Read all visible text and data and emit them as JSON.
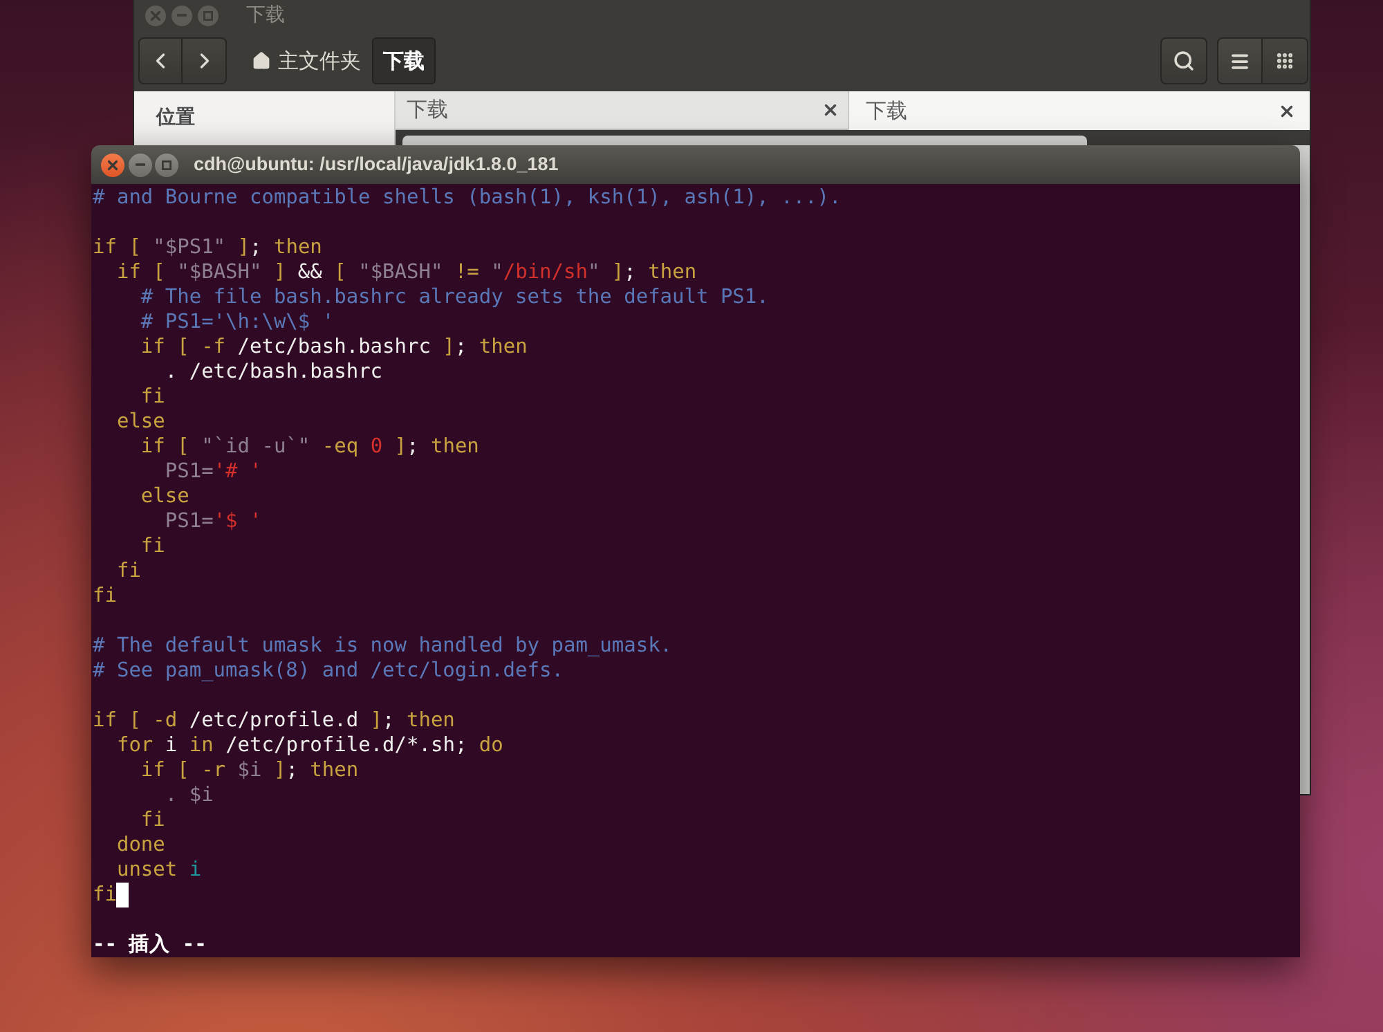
{
  "file_manager": {
    "title": "下载",
    "focused": false,
    "path": [
      {
        "label": "主文件夹",
        "selected": false
      },
      {
        "label": "下载",
        "selected": true
      }
    ],
    "sidebar": {
      "heading": "位置"
    },
    "tabs": [
      {
        "label": "下载",
        "selected": false
      },
      {
        "label": "下载",
        "selected": true
      }
    ]
  },
  "terminal": {
    "title": "cdh@ubuntu: /usr/local/java/jdk1.8.0_181",
    "focused": true,
    "blocks": [
      {
        "lines": [
          {
            "cursor": false,
            "tokens": [
              {
                "kind": "comment",
                "text": "# and Bourne compatible shells (bash(1), ksh(1), ash(1), ...)."
              }
            ]
          }
        ]
      },
      {
        "lines": [
          {
            "cursor": false,
            "tokens": [
              {
                "kind": "keyword",
                "text": "if [ "
              },
              {
                "kind": "variable",
                "text": "\"$PS1\""
              },
              {
                "kind": "keyword",
                "text": " ]"
              },
              {
                "kind": "plain",
                "text": ";"
              },
              {
                "kind": "keyword",
                "text": " then"
              }
            ]
          },
          {
            "cursor": false,
            "tokens": [
              {
                "kind": "keyword",
                "text": "  if [ "
              },
              {
                "kind": "variable",
                "text": "\"$BASH\""
              },
              {
                "kind": "keyword",
                "text": " ]"
              },
              {
                "kind": "plain",
                "text": " && "
              },
              {
                "kind": "keyword",
                "text": "[ "
              },
              {
                "kind": "variable",
                "text": "\"$BASH\""
              },
              {
                "kind": "keyword",
                "text": " != "
              },
              {
                "kind": "variable",
                "text": "\""
              },
              {
                "kind": "string",
                "text": "/bin/sh"
              },
              {
                "kind": "variable",
                "text": "\""
              },
              {
                "kind": "keyword",
                "text": " ]"
              },
              {
                "kind": "plain",
                "text": ";"
              },
              {
                "kind": "keyword",
                "text": " then"
              }
            ]
          },
          {
            "cursor": false,
            "tokens": [
              {
                "kind": "comment",
                "text": "    # The file bash.bashrc already sets the default PS1."
              }
            ]
          },
          {
            "cursor": false,
            "tokens": [
              {
                "kind": "comment",
                "text": "    # PS1='\\h:\\w\\$ '"
              }
            ]
          },
          {
            "cursor": false,
            "tokens": [
              {
                "kind": "keyword",
                "text": "    if [ -f "
              },
              {
                "kind": "plain",
                "text": "/etc/bash.bashrc"
              },
              {
                "kind": "keyword",
                "text": " ]"
              },
              {
                "kind": "plain",
                "text": ";"
              },
              {
                "kind": "keyword",
                "text": " then"
              }
            ]
          },
          {
            "cursor": false,
            "tokens": [
              {
                "kind": "plain",
                "text": "      . /etc/bash.bashrc"
              }
            ]
          },
          {
            "cursor": false,
            "tokens": [
              {
                "kind": "keyword",
                "text": "    fi"
              }
            ]
          },
          {
            "cursor": false,
            "tokens": [
              {
                "kind": "keyword",
                "text": "  else"
              }
            ]
          },
          {
            "cursor": false,
            "tokens": [
              {
                "kind": "keyword",
                "text": "    if [ "
              },
              {
                "kind": "variable",
                "text": "\"`id -u`\""
              },
              {
                "kind": "keyword",
                "text": " -eq "
              },
              {
                "kind": "string",
                "text": "0"
              },
              {
                "kind": "keyword",
                "text": " ]"
              },
              {
                "kind": "plain",
                "text": ";"
              },
              {
                "kind": "keyword",
                "text": " then"
              }
            ]
          },
          {
            "cursor": false,
            "tokens": [
              {
                "kind": "variable",
                "text": "      PS1="
              },
              {
                "kind": "string",
                "text": "'# '"
              }
            ]
          },
          {
            "cursor": false,
            "tokens": [
              {
                "kind": "keyword",
                "text": "    else"
              }
            ]
          },
          {
            "cursor": false,
            "tokens": [
              {
                "kind": "variable",
                "text": "      PS1="
              },
              {
                "kind": "string",
                "text": "'$ '"
              }
            ]
          },
          {
            "cursor": false,
            "tokens": [
              {
                "kind": "keyword",
                "text": "    fi"
              }
            ]
          },
          {
            "cursor": false,
            "tokens": [
              {
                "kind": "keyword",
                "text": "  fi"
              }
            ]
          },
          {
            "cursor": false,
            "tokens": [
              {
                "kind": "keyword",
                "text": "fi"
              }
            ]
          }
        ]
      },
      {
        "lines": [
          {
            "cursor": false,
            "tokens": [
              {
                "kind": "comment",
                "text": "# The default umask is now handled by pam_umask."
              }
            ]
          },
          {
            "cursor": false,
            "tokens": [
              {
                "kind": "comment",
                "text": "# See pam_umask(8) and /etc/login.defs."
              }
            ]
          }
        ]
      },
      {
        "lines": [
          {
            "cursor": false,
            "tokens": [
              {
                "kind": "keyword",
                "text": "if [ -d "
              },
              {
                "kind": "plain",
                "text": "/etc/profile.d"
              },
              {
                "kind": "keyword",
                "text": " ]"
              },
              {
                "kind": "plain",
                "text": ";"
              },
              {
                "kind": "keyword",
                "text": " then"
              }
            ]
          },
          {
            "cursor": false,
            "tokens": [
              {
                "kind": "keyword",
                "text": "  for"
              },
              {
                "kind": "plain",
                "text": " i "
              },
              {
                "kind": "keyword",
                "text": "in"
              },
              {
                "kind": "plain",
                "text": " /etc/profile.d/*.sh;"
              },
              {
                "kind": "keyword",
                "text": " do"
              }
            ]
          },
          {
            "cursor": false,
            "tokens": [
              {
                "kind": "keyword",
                "text": "    if [ -r "
              },
              {
                "kind": "variable",
                "text": "$i"
              },
              {
                "kind": "keyword",
                "text": " ]"
              },
              {
                "kind": "plain",
                "text": ";"
              },
              {
                "kind": "keyword",
                "text": " then"
              }
            ]
          },
          {
            "cursor": false,
            "tokens": [
              {
                "kind": "variable",
                "text": "      . $i"
              }
            ]
          },
          {
            "cursor": false,
            "tokens": [
              {
                "kind": "keyword",
                "text": "    fi"
              }
            ]
          },
          {
            "cursor": false,
            "tokens": [
              {
                "kind": "keyword",
                "text": "  done"
              }
            ]
          },
          {
            "cursor": false,
            "tokens": [
              {
                "kind": "keyword",
                "text": "  unset"
              },
              {
                "kind": "identifier",
                "text": " i"
              }
            ]
          },
          {
            "cursor": true,
            "tokens": [
              {
                "kind": "keyword",
                "text": "fi"
              }
            ]
          }
        ]
      }
    ],
    "mode": "-- 插入 --"
  }
}
